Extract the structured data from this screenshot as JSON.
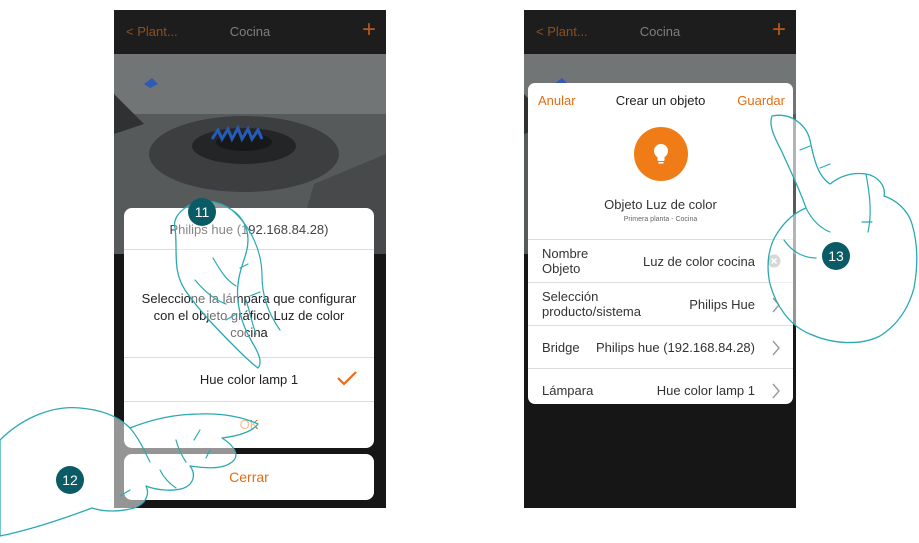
{
  "left_screen": {
    "nav": {
      "back": "< Plant...",
      "title": "Cocina",
      "add": "+"
    },
    "sheet": {
      "bridge_row": "Philips hue (192.168.84.28)",
      "instruction": "Seleccione la lámpara que configurar con el objeto gráfico Luz de color cocina",
      "lamp_option": "Hue color lamp 1",
      "ok_label": "OK"
    },
    "close_label": "Cerrar"
  },
  "right_screen": {
    "nav": {
      "back": "< Plant...",
      "title": "Cocina",
      "add": "+"
    },
    "dialog": {
      "cancel": "Anular",
      "title": "Crear un objeto",
      "save": "Guardar",
      "object_title": "Objeto Luz de color",
      "object_location": "Primera planta - Cocina",
      "rows": [
        {
          "label": "Nombre Objeto",
          "value": "Luz de color cocina"
        },
        {
          "label": "Selección producto/sistema",
          "value": "Philips Hue"
        },
        {
          "label": "Bridge",
          "value": "Philips hue (192.168.84.28)"
        },
        {
          "label": "Lámpara",
          "value": "Hue color lamp 1"
        }
      ]
    }
  },
  "steps": [
    "11",
    "12",
    "13"
  ],
  "colors": {
    "accent": "#e36d14",
    "step_badge": "#0a5b66",
    "dark_bg": "#1b1b1b",
    "icon_orange": "#f07c17"
  },
  "icons": [
    "lightbulb-icon",
    "clear-icon",
    "chevron-right-icon",
    "checkmark-icon",
    "plus-icon"
  ]
}
